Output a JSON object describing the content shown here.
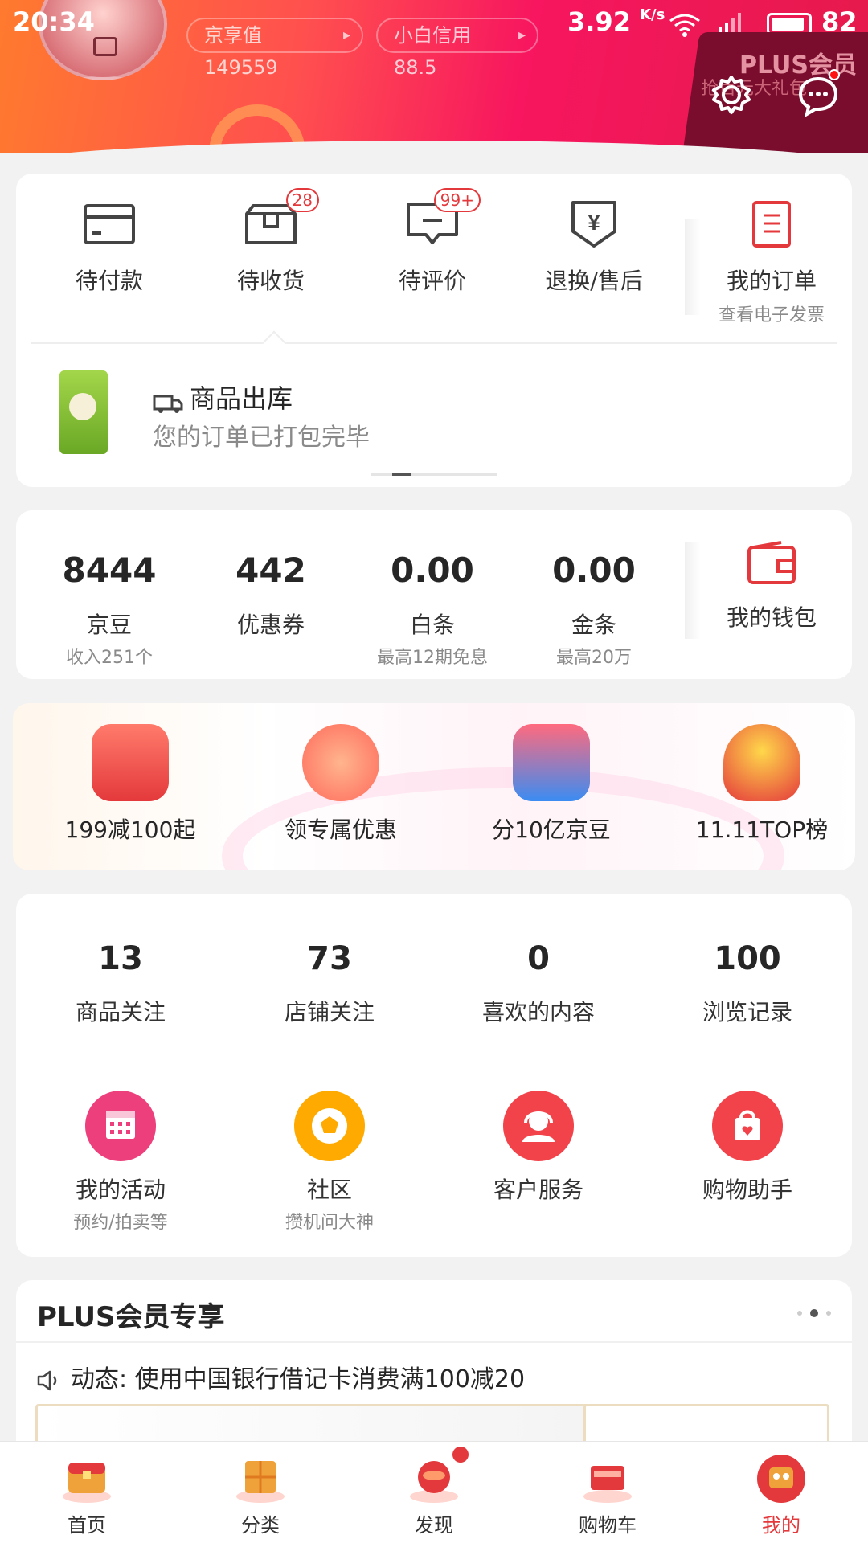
{
  "status_bar": {
    "time": "20:34",
    "speed": "3.92",
    "speed_unit": "K/s",
    "battery": "82"
  },
  "header": {
    "jingxiang_pill": "京享值149559",
    "xiaobai_pill": "小白信用88.5",
    "plus_label": "PLUS会员",
    "plus_sub": "抢百元大礼包"
  },
  "orders": [
    {
      "label": "待付款",
      "icon": "wallet-card-icon",
      "badge": ""
    },
    {
      "label": "待收货",
      "icon": "package-icon",
      "badge": "28"
    },
    {
      "label": "待评价",
      "icon": "comment-icon",
      "badge": "99+"
    },
    {
      "label": "退换/售后",
      "icon": "yen-shield-icon",
      "badge": ""
    },
    {
      "label": "我的订单",
      "icon": "clipboard-icon",
      "sub": "查看电子发票"
    }
  ],
  "logistics": {
    "title": "商品出库",
    "subtitle": "您的订单已打包完毕"
  },
  "wallet": [
    {
      "num": "8444",
      "label": "京豆",
      "sub": "收入251个"
    },
    {
      "num": "442",
      "label": "优惠券",
      "sub": ""
    },
    {
      "num": "0.00",
      "label": "白条",
      "sub": "最高12期免息"
    },
    {
      "num": "0.00",
      "label": "金条",
      "sub": "最高20万"
    },
    {
      "label": "我的钱包"
    }
  ],
  "promos": [
    {
      "label": "199减100起"
    },
    {
      "label": "领专属优惠"
    },
    {
      "label": "分10亿京豆"
    },
    {
      "label": "11.11TOP榜"
    }
  ],
  "stats": [
    {
      "num": "13",
      "label": "商品关注"
    },
    {
      "num": "73",
      "label": "店铺关注"
    },
    {
      "num": "0",
      "label": "喜欢的内容"
    },
    {
      "num": "100",
      "label": "浏览记录"
    }
  ],
  "tools": [
    {
      "label": "我的活动",
      "sub": "预约/拍卖等",
      "color": "#ec3f7c"
    },
    {
      "label": "社区",
      "sub": "攒机问大神",
      "color": "#ffaa00"
    },
    {
      "label": "客户服务",
      "sub": "",
      "color": "#f2434a"
    },
    {
      "label": "购物助手",
      "sub": "",
      "color": "#f2434a"
    }
  ],
  "plus_section": {
    "title": "PLUS会员专享",
    "notice": "动态: 使用中国银行借记卡消费满100减20"
  },
  "bottom_nav": [
    {
      "label": "首页"
    },
    {
      "label": "分类"
    },
    {
      "label": "发现"
    },
    {
      "label": "购物车"
    },
    {
      "label": "我的"
    }
  ],
  "colors": {
    "accent": "#e4393c",
    "header_start": "#ff7a2e",
    "header_end": "#e51a4b"
  }
}
